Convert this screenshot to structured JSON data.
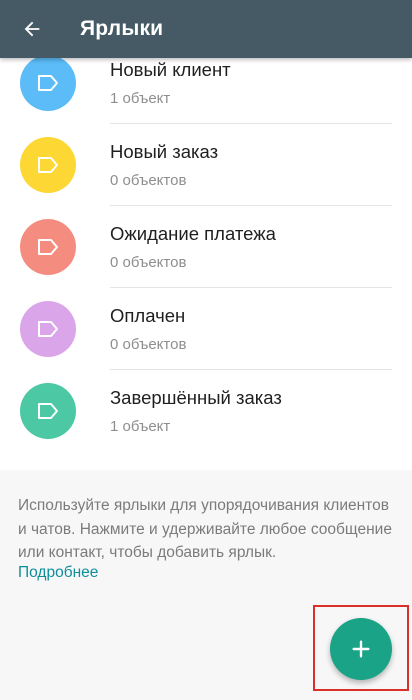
{
  "app_bar": {
    "title": "Ярлыки",
    "back_icon": "arrow-back-icon",
    "background": "#455a64"
  },
  "labels": [
    {
      "name": "Новый клиент",
      "count": "1 объект",
      "color": "#5bbcf7",
      "icon": "label-tag-icon"
    },
    {
      "name": "Новый заказ",
      "count": "0 объектов",
      "color": "#fdd734",
      "icon": "label-tag-icon"
    },
    {
      "name": "Ожидание платежа",
      "count": "0 объектов",
      "color": "#f58c80",
      "icon": "label-tag-icon"
    },
    {
      "name": "Оплачен",
      "count": "0 объектов",
      "color": "#dba5e9",
      "icon": "label-tag-icon"
    },
    {
      "name": "Завершённый заказ",
      "count": "1 объект",
      "color": "#4cc9a4",
      "icon": "label-tag-icon"
    }
  ],
  "info": {
    "text": "Используйте ярлыки для упорядочивания клиентов и чатов. Нажмите и удерживайте любое сообщение или контакт, чтобы добавить ярлык.",
    "link": "Подробнее"
  },
  "fab": {
    "icon": "plus-icon",
    "color": "#1aa386",
    "highlight_color": "#d9302c"
  }
}
